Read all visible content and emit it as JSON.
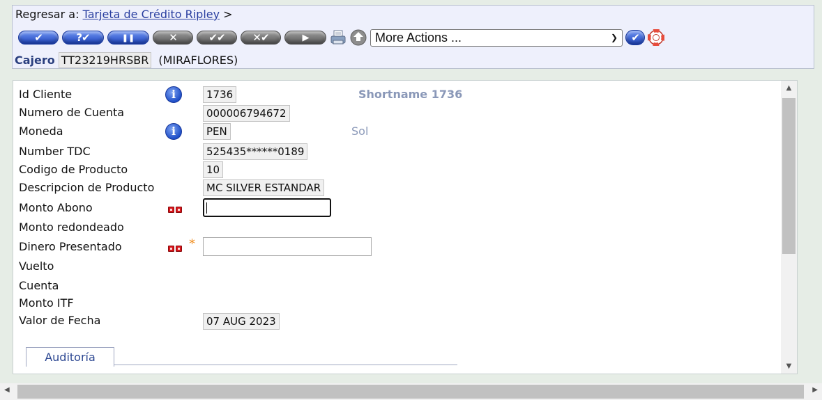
{
  "header": {
    "back_prefix": "Regresar a:",
    "back_link": "Tarjeta de Crédito Ripley",
    "back_suffix": ">"
  },
  "toolbar": {
    "buttons": [
      {
        "name": "commit",
        "icon": "check-icon",
        "glyph": "✔",
        "color": "blue"
      },
      {
        "name": "validate",
        "icon": "question-check-icon",
        "glyph": "?✔",
        "color": "blue"
      },
      {
        "name": "hold",
        "icon": "pause-icon",
        "glyph": "❚❚",
        "color": "blue"
      },
      {
        "name": "delete",
        "icon": "x-icon",
        "glyph": "✕",
        "color": "grey"
      },
      {
        "name": "authorise",
        "icon": "double-check-icon",
        "glyph": "✔✔",
        "color": "grey"
      },
      {
        "name": "reverse",
        "icon": "x-check-icon",
        "glyph": "✕✔",
        "color": "grey"
      },
      {
        "name": "next",
        "icon": "arrow-right-icon",
        "glyph": "▶",
        "color": "grey"
      }
    ],
    "more_actions": "More Actions ...",
    "colors": {
      "blue": "#2a52cf",
      "grey": "#6a6a6a"
    }
  },
  "cajero": {
    "label": "Cajero",
    "value": "TT23219HRSBR",
    "branch": "(MIRAFLORES)"
  },
  "form": {
    "id_cliente": {
      "label": "Id Cliente",
      "value": "1736",
      "desc": "Shortname 1736"
    },
    "numero_cuenta": {
      "label": "Numero de Cuenta",
      "value": "000006794672"
    },
    "moneda": {
      "label": "Moneda",
      "value": "PEN",
      "desc": "Sol"
    },
    "number_tdc": {
      "label": "Number TDC",
      "value": "525435******0189"
    },
    "codigo_producto": {
      "label": "Codigo de Producto",
      "value": "10"
    },
    "descripcion_producto": {
      "label": "Descripcion de Producto",
      "value": "MC SILVER ESTANDAR"
    },
    "monto_abono": {
      "label": "Monto Abono",
      "value": ""
    },
    "monto_redondeado": {
      "label": "Monto redondeado"
    },
    "dinero_presentado": {
      "label": "Dinero Presentado",
      "value": "",
      "required_mark": "*"
    },
    "vuelto": {
      "label": "Vuelto"
    },
    "cuenta": {
      "label": "Cuenta"
    },
    "monto_itf": {
      "label": "Monto ITF"
    },
    "valor_fecha": {
      "label": "Valor de Fecha",
      "value": "07 AUG 2023"
    }
  },
  "tabs": {
    "auditoria": "Auditoría"
  }
}
